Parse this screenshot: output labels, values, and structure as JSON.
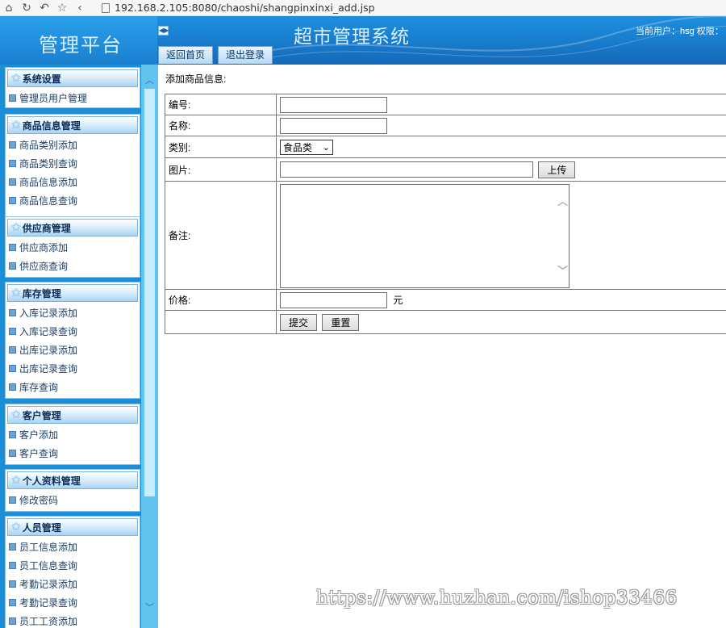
{
  "browser": {
    "url": "192.168.2.105:8080/chaoshi/shangpinxinxi_add.jsp"
  },
  "header": {
    "platform_title": "管理平台",
    "system_title": "超市管理系统",
    "user_info": "当前用户：hsg  权限：",
    "tabs": [
      {
        "label": "返回首页"
      },
      {
        "label": "退出登录"
      }
    ]
  },
  "sidebar": {
    "panels": [
      {
        "title": "系统设置",
        "items": [
          "管理员用户管理"
        ]
      },
      {
        "title": "商品信息管理",
        "items": [
          "商品类别添加",
          "商品类别查询",
          "商品信息添加",
          "商品信息查询"
        ]
      },
      {
        "title": "供应商管理",
        "items": [
          "供应商添加",
          "供应商查询"
        ]
      },
      {
        "title": "库存管理",
        "items": [
          "入库记录添加",
          "入库记录查询",
          "出库记录添加",
          "出库记录查询",
          "库存查询"
        ]
      },
      {
        "title": "客户管理",
        "items": [
          "客户添加",
          "客户查询"
        ]
      },
      {
        "title": "个人资料管理",
        "items": [
          "修改密码"
        ]
      },
      {
        "title": "人员管理",
        "items": [
          "员工信息添加",
          "员工信息查询",
          "考勤记录添加",
          "考勤记录查询",
          "员工工资添加"
        ]
      }
    ]
  },
  "main": {
    "heading": "添加商品信息:",
    "form": {
      "id_label": "编号:",
      "id_value": "",
      "name_label": "名称:",
      "name_value": "",
      "category_label": "类别:",
      "category_value": "食品类",
      "image_label": "图片:",
      "image_value": "",
      "upload_button": "上传",
      "note_label": "备注:",
      "note_value": "",
      "price_label": "价格:",
      "price_value": "",
      "price_unit": "元",
      "submit_button": "提交",
      "reset_button": "重置"
    }
  },
  "watermark": "https://www.huzhan.com/ishop33466",
  "colors": {
    "header_blue": "#1a7fd0",
    "sidebar_blue": "#1a8fd8",
    "scrollbar": "#63c3ef"
  },
  "icons": {
    "home": "home-icon",
    "refresh": "refresh-icon",
    "undo": "undo-icon",
    "favorite": "star-icon",
    "back": "back-arrow-icon",
    "page": "page-icon",
    "collapse": "collapse-toggle-icon",
    "panel_header": "star-icon",
    "menu_item": "bullet-icon"
  }
}
